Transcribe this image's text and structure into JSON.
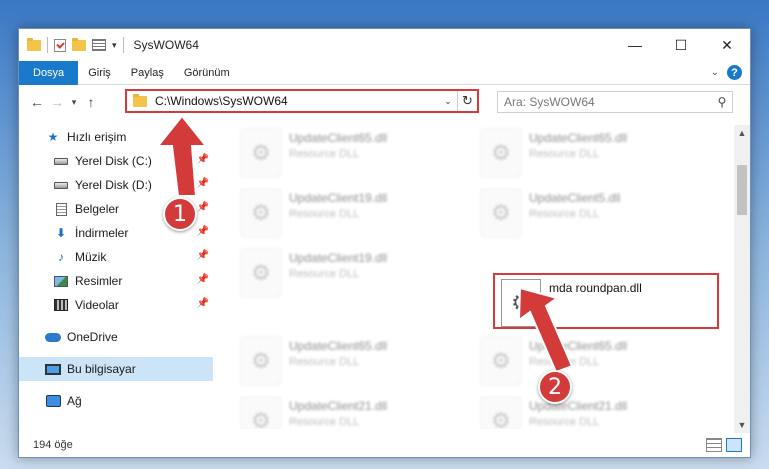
{
  "window": {
    "title": "SysWOW64"
  },
  "controls": {
    "minimize": "—",
    "maximize": "☐",
    "close": "✕"
  },
  "ribbon": {
    "tabs": [
      {
        "label": "Dosya",
        "active": true
      },
      {
        "label": "Giriş"
      },
      {
        "label": "Paylaş"
      },
      {
        "label": "Görünüm"
      }
    ],
    "help": "?"
  },
  "nav": {
    "back": "←",
    "forward": "→",
    "recent": "▾",
    "up": "↑",
    "address": "C:\\Windows\\SysWOW64",
    "search_placeholder": "Ara: SysWOW64"
  },
  "sidebar": {
    "items": [
      {
        "label": "Hızlı erişim",
        "icon": "star-icon"
      },
      {
        "label": "Yerel Disk (C:)",
        "icon": "drive-icon",
        "pinned": true
      },
      {
        "label": "Yerel Disk (D:)",
        "icon": "drive-icon",
        "pinned": true
      },
      {
        "label": "Belgeler",
        "icon": "document-icon",
        "pinned": true
      },
      {
        "label": "İndirmeler",
        "icon": "download-icon",
        "pinned": true
      },
      {
        "label": "Müzik",
        "icon": "music-icon",
        "pinned": true
      },
      {
        "label": "Resimler",
        "icon": "pictures-icon",
        "pinned": true
      },
      {
        "label": "Videolar",
        "icon": "videos-icon",
        "pinned": true
      },
      {
        "label": "OneDrive",
        "icon": "cloud-icon"
      },
      {
        "label": "Bu bilgisayar",
        "icon": "computer-icon",
        "selected": true
      },
      {
        "label": "Ağ",
        "icon": "network-icon"
      }
    ]
  },
  "files": [
    {
      "name": "UpdateClient65.dll",
      "type": "Resource DLL"
    },
    {
      "name": "UpdateClient65.dll",
      "type": "Resource DLL"
    },
    {
      "name": "UpdateClient19.dll",
      "type": "Resource DLL"
    },
    {
      "name": "UpdateClient5.dll",
      "type": "Resource DLL"
    },
    {
      "name": "UpdateClient19.dll",
      "type": "Resource DLL"
    },
    {
      "name": "mda roundpan.dll",
      "type": ""
    },
    {
      "name": "UpdateClient65.dll",
      "type": "Resource DLL"
    },
    {
      "name": "UpdateClient65.dll",
      "type": "Resource DLL"
    },
    {
      "name": "UpdateClient21.dll",
      "type": "Resource DLL"
    },
    {
      "name": "UpdateClient21.dll",
      "type": "Resource DLL"
    }
  ],
  "status": {
    "count": "194 öğe"
  },
  "annotations": {
    "step1": "1",
    "step2": "2",
    "accent": "#d33b3b"
  }
}
